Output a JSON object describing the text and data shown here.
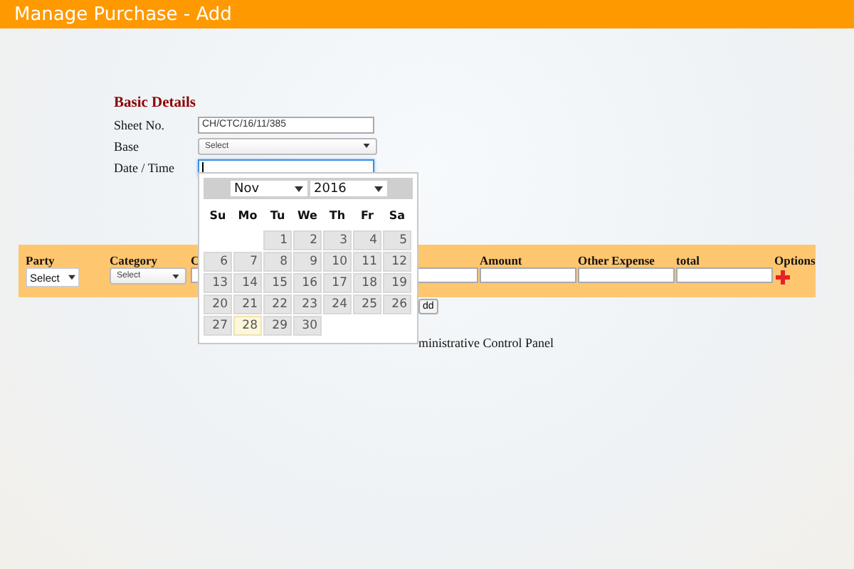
{
  "header": {
    "title": "Manage Purchase - Add"
  },
  "basic_details": {
    "heading": "Basic Details",
    "fields": [
      {
        "label": "Sheet No.",
        "kind": "text",
        "value": "CH/CTC/16/11/385",
        "focused": false
      },
      {
        "label": "Base",
        "kind": "select",
        "value": "Select"
      },
      {
        "label": "Date / Time",
        "kind": "text",
        "focused": true
      }
    ]
  },
  "table": {
    "columns": [
      {
        "header": "Party",
        "field": {
          "kind": "native-select",
          "value": "Select"
        }
      },
      {
        "header": "Category",
        "field": {
          "kind": "select",
          "value": "Select"
        }
      },
      {
        "header": "C",
        "field": {
          "kind": "input"
        }
      },
      {
        "field": {
          "kind": "input"
        }
      },
      {
        "header": "Amount",
        "field": {
          "kind": "input"
        }
      },
      {
        "header": "Other Expense",
        "field": {
          "kind": "input"
        }
      },
      {
        "header": "total",
        "field": {
          "kind": "input"
        }
      },
      {
        "header": "Options",
        "field": {
          "kind": "add"
        }
      }
    ]
  },
  "add_button": "dd",
  "footer_text": "ministrative Control Panel",
  "datepicker": {
    "month": "Nov",
    "year": "2016",
    "weekdays": [
      "Su",
      "Mo",
      "Tu",
      "We",
      "Th",
      "Fr",
      "Sa"
    ],
    "weeks": [
      [
        {
          "kind": "blank"
        },
        {
          "kind": "blank"
        },
        {
          "kind": "day",
          "label": "1",
          "today": false
        },
        {
          "kind": "day",
          "label": "2",
          "today": false
        },
        {
          "kind": "day",
          "label": "3",
          "today": false
        },
        {
          "kind": "day",
          "label": "4",
          "today": false
        },
        {
          "kind": "day",
          "label": "5",
          "today": false
        }
      ],
      [
        {
          "kind": "day",
          "label": "6",
          "today": false
        },
        {
          "kind": "day",
          "label": "7",
          "today": false
        },
        {
          "kind": "day",
          "label": "8",
          "today": false
        },
        {
          "kind": "day",
          "label": "9",
          "today": false
        },
        {
          "kind": "day",
          "label": "10",
          "today": false
        },
        {
          "kind": "day",
          "label": "11",
          "today": false
        },
        {
          "kind": "day",
          "label": "12",
          "today": false
        }
      ],
      [
        {
          "kind": "day",
          "label": "13",
          "today": false
        },
        {
          "kind": "day",
          "label": "14",
          "today": false
        },
        {
          "kind": "day",
          "label": "15",
          "today": false
        },
        {
          "kind": "day",
          "label": "16",
          "today": false
        },
        {
          "kind": "day",
          "label": "17",
          "today": false
        },
        {
          "kind": "day",
          "label": "18",
          "today": false
        },
        {
          "kind": "day",
          "label": "19",
          "today": false
        }
      ],
      [
        {
          "kind": "day",
          "label": "20",
          "today": false
        },
        {
          "kind": "day",
          "label": "21",
          "today": false
        },
        {
          "kind": "day",
          "label": "22",
          "today": false
        },
        {
          "kind": "day",
          "label": "23",
          "today": false
        },
        {
          "kind": "day",
          "label": "24",
          "today": false
        },
        {
          "kind": "day",
          "label": "25",
          "today": false
        },
        {
          "kind": "day",
          "label": "26",
          "today": false
        }
      ],
      [
        {
          "kind": "day",
          "label": "27",
          "today": false
        },
        {
          "kind": "day",
          "label": "28",
          "today": true
        },
        {
          "kind": "day",
          "label": "29",
          "today": false
        },
        {
          "kind": "day",
          "label": "30",
          "today": false
        },
        {
          "kind": "blank"
        },
        {
          "kind": "blank"
        },
        {
          "kind": "blank"
        }
      ]
    ]
  }
}
